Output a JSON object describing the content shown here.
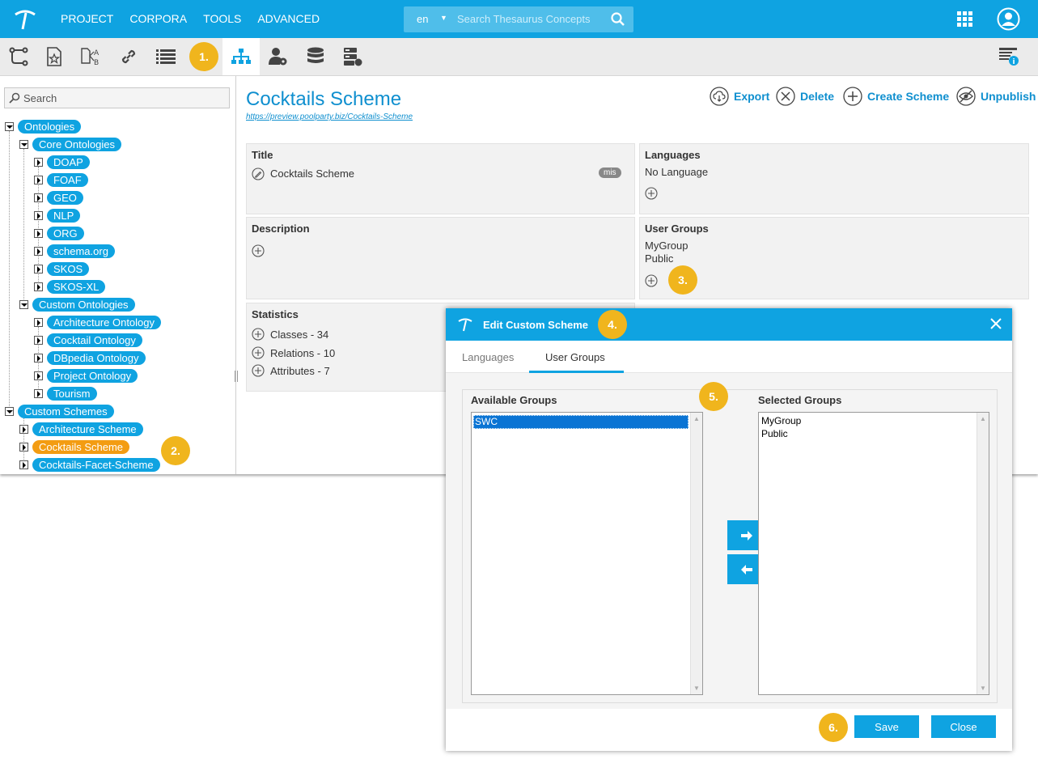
{
  "topbar": {
    "menu": [
      "PROJECT",
      "CORPORA",
      "TOOLS",
      "ADVANCED"
    ],
    "search": {
      "lang": "en",
      "placeholder": "Search Thesaurus Concepts"
    }
  },
  "toolbar": {
    "icons": [
      "hierarchy-tree-icon",
      "favorites-icon",
      "alignment-icon",
      "link-icon",
      "list-icon",
      "org-chart-icon",
      "user-settings-icon",
      "database-icon",
      "server-icon",
      "info-panel-icon"
    ]
  },
  "badges": {
    "b1": "1.",
    "b2": "2.",
    "b3": "3.",
    "b4": "4.",
    "b5": "5.",
    "b6": "6."
  },
  "tree": {
    "search_placeholder": "Search",
    "ontologies": "Ontologies",
    "core_ontologies": "Core Ontologies",
    "core": [
      "DOAP",
      "FOAF",
      "GEO",
      "NLP",
      "ORG",
      "schema.org",
      "SKOS",
      "SKOS-XL"
    ],
    "custom_ontologies": "Custom Ontologies",
    "custom": [
      "Architecture Ontology",
      "Cocktail Ontology",
      "DBpedia Ontology",
      "Project Ontology",
      "Tourism"
    ],
    "custom_schemes": "Custom Schemes",
    "schemes": [
      "Architecture Scheme",
      "Cocktails Scheme",
      "Cocktails-Facet-Scheme"
    ]
  },
  "main": {
    "title": "Cocktails Scheme",
    "url": "https://preview.poolparty.biz/Cocktails-Scheme",
    "actions": {
      "export": "Export",
      "delete": "Delete",
      "create": "Create Scheme",
      "unpublish": "Unpublish"
    },
    "title_panel": {
      "heading": "Title",
      "value": "Cocktails Scheme",
      "lang_tag": "mis"
    },
    "languages_panel": {
      "heading": "Languages",
      "value": "No Language"
    },
    "description_panel": {
      "heading": "Description"
    },
    "usergroups_panel": {
      "heading": "User Groups",
      "values": [
        "MyGroup",
        "Public"
      ]
    },
    "statistics_panel": {
      "heading": "Statistics",
      "items": [
        "Classes - 34",
        "Relations - 10",
        "Attributes - 7"
      ]
    }
  },
  "dialog": {
    "title": "Edit Custom Scheme",
    "tabs": [
      "Languages",
      "User Groups"
    ],
    "available_label": "Available Groups",
    "available": [
      "SWC"
    ],
    "selected_label": "Selected Groups",
    "selected": [
      "MyGroup",
      "Public"
    ],
    "save": "Save",
    "close": "Close"
  },
  "colors": {
    "accent": "#0fa3e1",
    "selected_node": "#f39c12",
    "badge": "#f0b51d"
  }
}
